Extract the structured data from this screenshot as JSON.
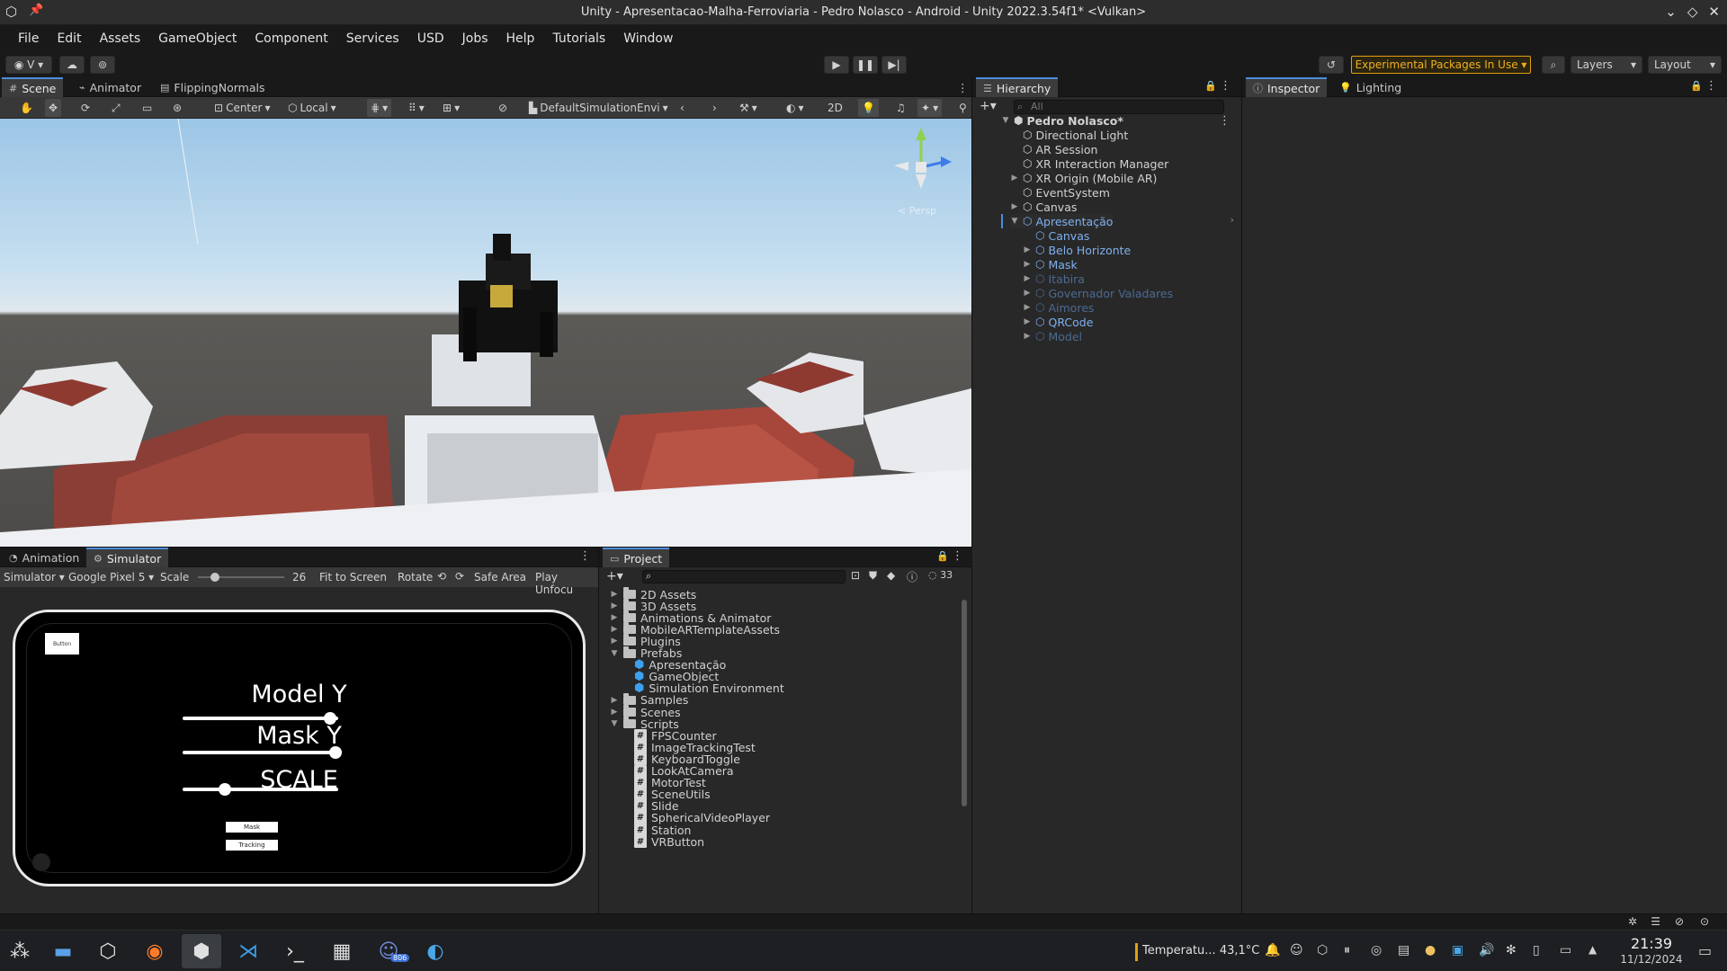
{
  "window": {
    "title": "Unity - Apresentacao-Malha-Ferroviaria - Pedro Nolasco - Android - Unity 2022.3.54f1* <Vulkan>"
  },
  "menu": [
    "File",
    "Edit",
    "Assets",
    "GameObject",
    "Component",
    "Services",
    "USD",
    "Jobs",
    "Help",
    "Tutorials",
    "Window"
  ],
  "toolbar": {
    "account_label": "V",
    "experimental": "Experimental Packages In Use",
    "layers": "Layers",
    "layout": "Layout"
  },
  "scene_tabs": [
    "Scene",
    "Animator",
    "FlippingNormals"
  ],
  "scene_toolbar": {
    "pivot": "Center",
    "space": "Local",
    "environment": "DefaultSimulationEnvi",
    "two_d": "2D",
    "persp": "< Persp"
  },
  "hierarchy": {
    "tab": "Hierarchy",
    "search_placeholder": "All",
    "scene": "Pedro Nolasco*",
    "items": [
      {
        "label": "Directional Light",
        "depth": 1,
        "arrow": "",
        "style": "normal"
      },
      {
        "label": "AR Session",
        "depth": 1,
        "arrow": "",
        "style": "normal"
      },
      {
        "label": "XR Interaction Manager",
        "depth": 1,
        "arrow": "",
        "style": "normal"
      },
      {
        "label": "XR Origin (Mobile AR)",
        "depth": 1,
        "arrow": "▶",
        "style": "normal"
      },
      {
        "label": "EventSystem",
        "depth": 1,
        "arrow": "",
        "style": "normal"
      },
      {
        "label": "Canvas",
        "depth": 1,
        "arrow": "▶",
        "style": "normal"
      },
      {
        "label": "Apresentação",
        "depth": 1,
        "arrow": "▼",
        "style": "blue"
      },
      {
        "label": "Canvas",
        "depth": 2,
        "arrow": "",
        "style": "blue"
      },
      {
        "label": "Belo Horizonte",
        "depth": 2,
        "arrow": "▶",
        "style": "blue"
      },
      {
        "label": "Mask",
        "depth": 2,
        "arrow": "▶",
        "style": "blue"
      },
      {
        "label": "Itabira",
        "depth": 2,
        "arrow": "▶",
        "style": "dim"
      },
      {
        "label": "Governador Valadares",
        "depth": 2,
        "arrow": "▶",
        "style": "dim"
      },
      {
        "label": "Aimores",
        "depth": 2,
        "arrow": "▶",
        "style": "dim"
      },
      {
        "label": "QRCode",
        "depth": 2,
        "arrow": "▶",
        "style": "blue"
      },
      {
        "label": "Model",
        "depth": 2,
        "arrow": "▶",
        "style": "dim"
      }
    ]
  },
  "inspector_tabs": [
    "Inspector",
    "Lighting"
  ],
  "bottom_left_tabs": [
    "Animation",
    "Simulator"
  ],
  "simulator": {
    "mode": "Simulator",
    "device": "Google Pixel 5",
    "scale_label": "Scale",
    "scale_value": "26",
    "fit": "Fit to Screen",
    "rotate": "Rotate",
    "safe_area": "Safe Area",
    "play_unfocused": "Play Unfocu",
    "screen": {
      "corner_button": "Button",
      "model_y_label": "Model Y",
      "model_y_value": 0.95,
      "mask_y_label": "Mask Y",
      "mask_y_value": 0.98,
      "scale_label": "SCALE",
      "scale_value": 0.27,
      "mask_button": "Mask",
      "tracking_button": "Tracking"
    }
  },
  "project": {
    "tab": "Project",
    "hidden_count": "33",
    "items": [
      {
        "label": "2D Assets",
        "type": "folder",
        "arrow": "▶",
        "depth": 0
      },
      {
        "label": "3D Assets",
        "type": "folder",
        "arrow": "▶",
        "depth": 0
      },
      {
        "label": "Animations & Animator",
        "type": "folder",
        "arrow": "▶",
        "depth": 0
      },
      {
        "label": "MobileARTemplateAssets",
        "type": "folder",
        "arrow": "▶",
        "depth": 0
      },
      {
        "label": "Plugins",
        "type": "folder",
        "arrow": "▶",
        "depth": 0
      },
      {
        "label": "Prefabs",
        "type": "folder",
        "arrow": "▼",
        "depth": 0
      },
      {
        "label": "Apresentação",
        "type": "prefab",
        "arrow": "",
        "depth": 1
      },
      {
        "label": "GameObject",
        "type": "prefab",
        "arrow": "",
        "depth": 1
      },
      {
        "label": "Simulation Environment",
        "type": "prefab",
        "arrow": "",
        "depth": 1
      },
      {
        "label": "Samples",
        "type": "folder",
        "arrow": "▶",
        "depth": 0
      },
      {
        "label": "Scenes",
        "type": "folder",
        "arrow": "▶",
        "depth": 0
      },
      {
        "label": "Scripts",
        "type": "folder",
        "arrow": "▼",
        "depth": 0
      },
      {
        "label": "FPSCounter",
        "type": "script",
        "arrow": "",
        "depth": 1
      },
      {
        "label": "ImageTrackingTest",
        "type": "script",
        "arrow": "",
        "depth": 1
      },
      {
        "label": "KeyboardToggle",
        "type": "script",
        "arrow": "",
        "depth": 1
      },
      {
        "label": "LookAtCamera",
        "type": "script",
        "arrow": "",
        "depth": 1
      },
      {
        "label": "MotorTest",
        "type": "script",
        "arrow": "",
        "depth": 1
      },
      {
        "label": "SceneUtils",
        "type": "script",
        "arrow": "",
        "depth": 1
      },
      {
        "label": "Slide",
        "type": "script",
        "arrow": "",
        "depth": 1
      },
      {
        "label": "SphericalVideoPlayer",
        "type": "script",
        "arrow": "",
        "depth": 1
      },
      {
        "label": "Station",
        "type": "script",
        "arrow": "",
        "depth": 1
      },
      {
        "label": "VRButton",
        "type": "script",
        "arrow": "",
        "depth": 1
      }
    ]
  },
  "taskbar": {
    "temperature": "Temperatu... 43,1°C",
    "time": "21:39",
    "date": "11/12/2024",
    "discord_badge": "806"
  },
  "colors": {
    "accent": "#4c8cda",
    "experimental": "#f0b020",
    "hierarchy_prefab": "#7fb0ef",
    "hierarchy_prefab_inactive": "#4c6a93"
  }
}
